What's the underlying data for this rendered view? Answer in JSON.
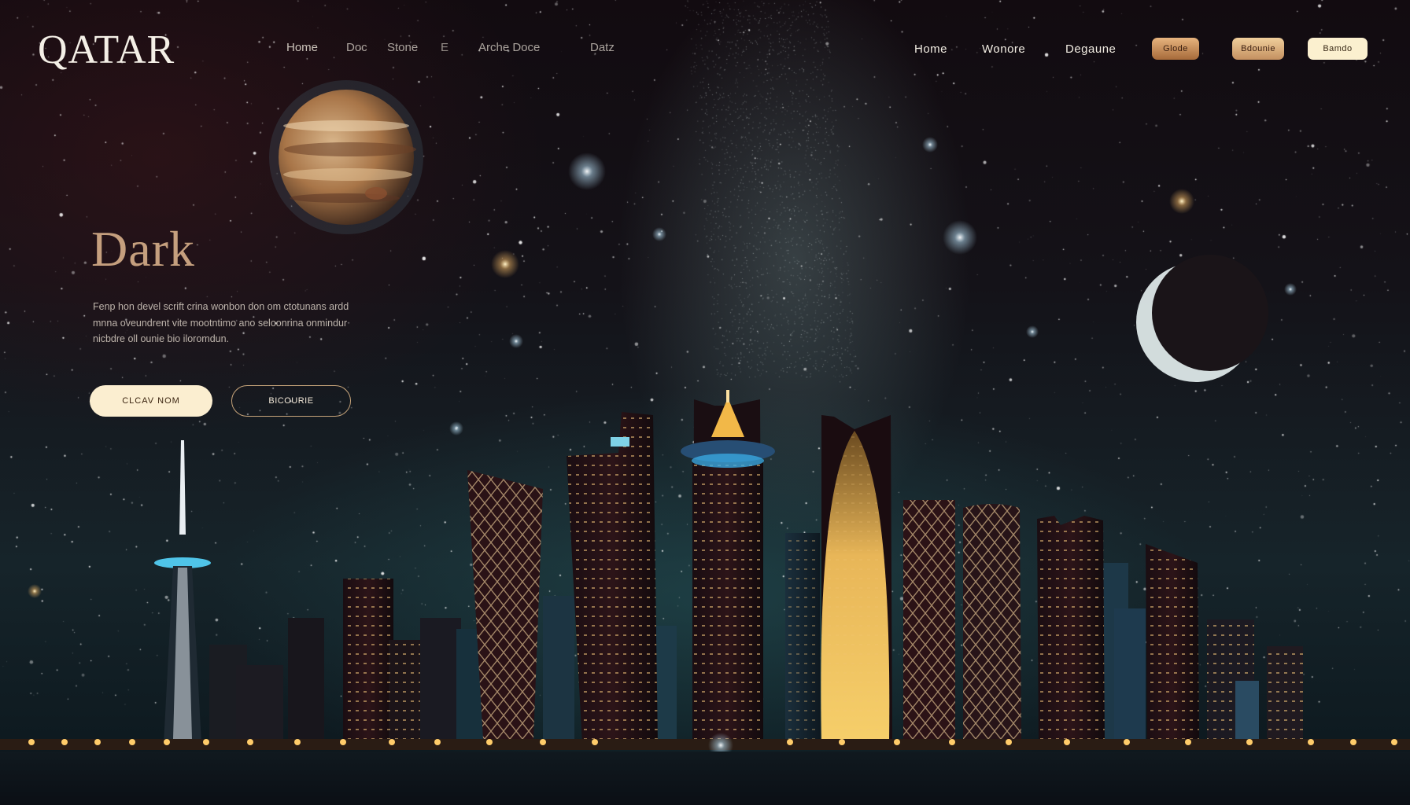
{
  "header": {
    "brand": "QATAR",
    "nav_left": [
      "Home",
      "Doc",
      "Stone",
      "E",
      "Arche Doce",
      "Datz"
    ],
    "nav_right": [
      "Home",
      "Wonore",
      "Degaune"
    ],
    "pills": [
      "Glode",
      "Bdounie",
      "Bamdo"
    ]
  },
  "hero": {
    "title": "Dark",
    "text": "Fenp hon devel scrift crina wonbon don om ctotunans ardd mnna oveundrent vite mootntimo ano seloonrina onmindur nicbdre oll ounie bio iloromdun.",
    "primary_button": "CLCAV NOM",
    "secondary_button": "BICOURIE"
  },
  "colors": {
    "accent_gold": "#d7b08a",
    "button_cream": "#fbeed0",
    "night_sky": "#141218",
    "city_teal": "#285f64"
  }
}
